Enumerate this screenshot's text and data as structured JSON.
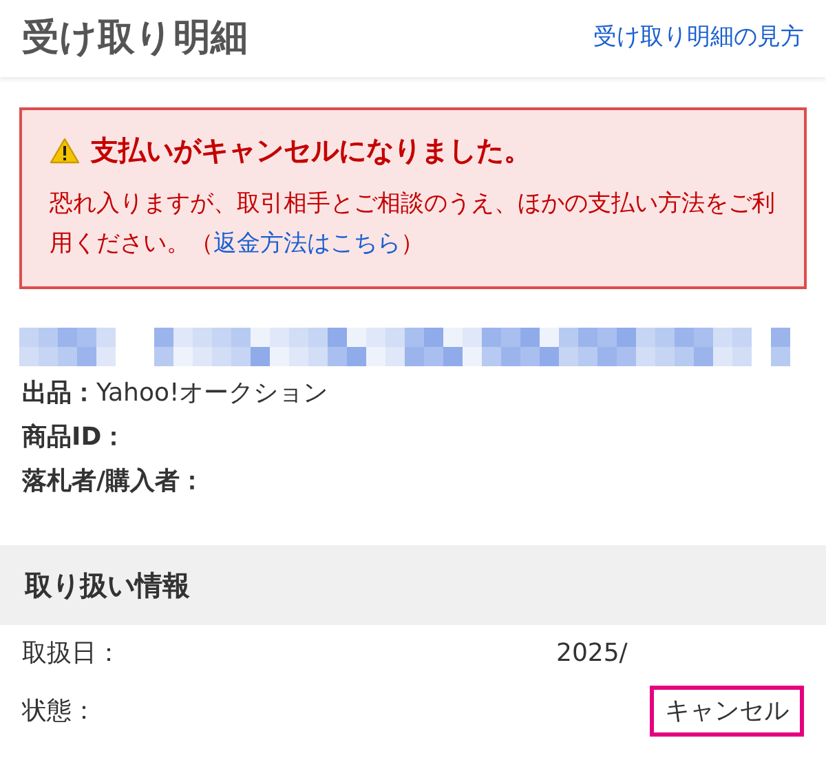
{
  "header": {
    "title": "受け取り明細",
    "help_link": "受け取り明細の見方"
  },
  "alert": {
    "title": "支払いがキャンセルになりました。",
    "body": "恐れ入りますが、取引相手とご相談のうえ、ほかの支払い方法をご利用ください。（",
    "link": "返金方法はこちら",
    "body_end": "）"
  },
  "details": [
    {
      "label": "出品：",
      "value": "Yahoo!オークション"
    },
    {
      "label": "商品ID："
    },
    {
      "label": "落札者/購入者："
    }
  ],
  "handling": {
    "title": "取り扱い情報",
    "rows": [
      {
        "label": "取扱日：",
        "value": "2025/",
        "highlighted": false
      },
      {
        "label": "状態：",
        "value": "キャンセル",
        "highlighted": true
      }
    ]
  }
}
